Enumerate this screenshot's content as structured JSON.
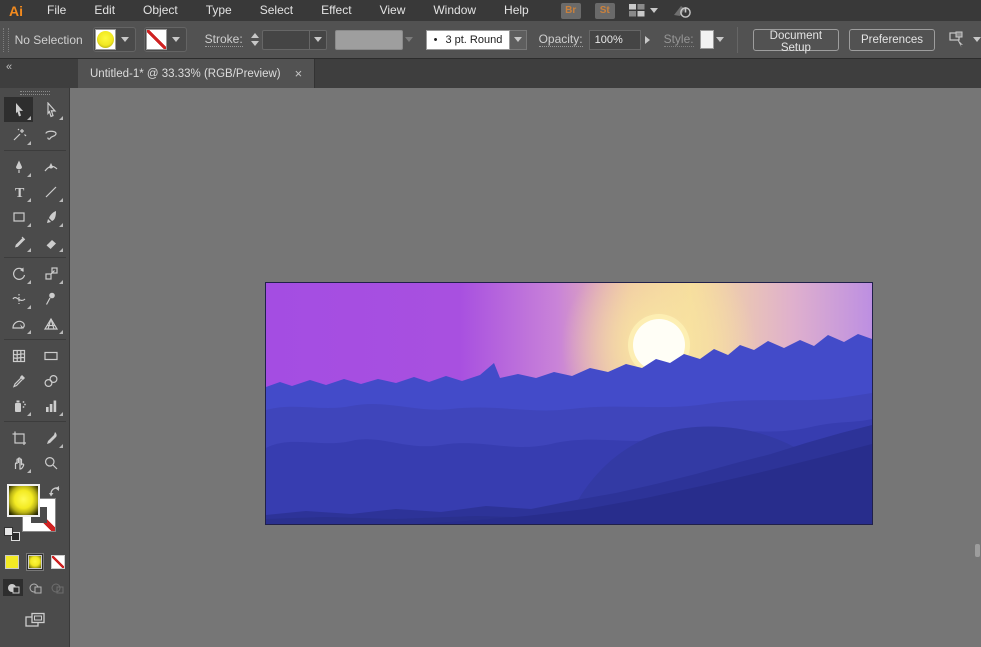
{
  "app": {
    "logo_text": "Ai"
  },
  "menu": {
    "items": [
      "File",
      "Edit",
      "Object",
      "Type",
      "Select",
      "Effect",
      "View",
      "Window",
      "Help"
    ]
  },
  "topbar": {
    "bridge_label": "Br",
    "stock_label": "St"
  },
  "control_bar": {
    "selection_status": "No Selection",
    "stroke_label": "Stroke:",
    "brush_dot": "•",
    "brush_name": "3 pt. Round",
    "opacity_label": "Opacity:",
    "opacity_value": "100%",
    "style_label": "Style:",
    "document_setup_label": "Document Setup",
    "preferences_label": "Preferences"
  },
  "tab": {
    "title": "Untitled-1* @ 33.33% (RGB/Preview)",
    "close_glyph": "×"
  },
  "toolbar": {
    "collapse_glyph": "«",
    "selected_tool": "selection-tool",
    "tools": [
      "selection-tool",
      "direct-selection-tool",
      "magic-wand-tool",
      "lasso-tool",
      "pen-tool",
      "curvature-tool",
      "type-tool",
      "line-segment-tool",
      "rectangle-tool",
      "paintbrush-tool",
      "shaper-tool",
      "eraser-tool",
      "rotate-tool",
      "scale-tool",
      "width-tool",
      "puppet-warp-tool",
      "shape-builder-tool",
      "perspective-grid-tool",
      "mesh-tool",
      "gradient-tool",
      "eyedropper-tool",
      "blend-tool",
      "symbol-sprayer-tool",
      "column-graph-tool",
      "artboard-tool",
      "slice-tool",
      "hand-tool",
      "zoom-tool"
    ]
  },
  "artwork": {
    "sky_stops": [
      {
        "color": "#a44de2"
      },
      {
        "color": "#a850e0"
      },
      {
        "color": "#c983d8"
      },
      {
        "color": "#eec3a6"
      },
      {
        "color": "#f6dc9b"
      },
      {
        "color": "#dfb0cd"
      },
      {
        "color": "#bd8fe2"
      }
    ],
    "sun": {
      "halo": "#fdf0b4",
      "core": "#fffef6",
      "glow": "#f8e3a2"
    },
    "mountains": {
      "main_ridge": "#434bc9",
      "haze_band": "#3f45bb",
      "mid_hills": "#373db0",
      "big_hill": "#333aa4",
      "foreground": "#2d3398",
      "bottom_strip": "#2a308e",
      "foreground_dark": "#282d8c"
    }
  },
  "ui_colors": {
    "accent_orange": "#f28a1e",
    "panel_dark": "#393939",
    "panel_mid": "#525252",
    "pasteboard": "#767676"
  }
}
